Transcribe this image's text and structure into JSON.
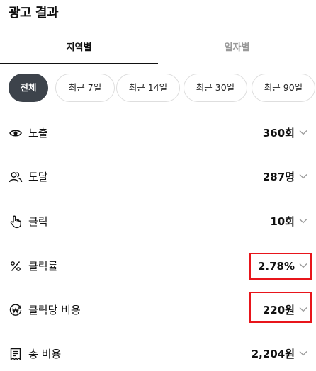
{
  "page": {
    "title": "광고 결과"
  },
  "tabs": [
    {
      "label": "지역별",
      "active": true
    },
    {
      "label": "일자별",
      "active": false
    }
  ],
  "periods": [
    {
      "label": "전체",
      "active": true
    },
    {
      "label": "최근 7일",
      "active": false
    },
    {
      "label": "최근 14일",
      "active": false
    },
    {
      "label": "최근 30일",
      "active": false
    },
    {
      "label": "최근 90일",
      "active": false
    }
  ],
  "metrics": [
    {
      "label": "노출",
      "value": "360회",
      "icon": "eye-icon"
    },
    {
      "label": "도달",
      "value": "287명",
      "icon": "people-icon"
    },
    {
      "label": "클릭",
      "value": "10회",
      "icon": "hand-pointer-icon"
    },
    {
      "label": "클릭률",
      "value": "2.78%",
      "icon": "percent-icon",
      "highlighted": true
    },
    {
      "label": "클릭당 비용",
      "value": "220원",
      "icon": "won-coin-icon",
      "highlighted": true
    },
    {
      "label": "총 비용",
      "value": "2,204원",
      "icon": "receipt-icon"
    }
  ],
  "colors": {
    "highlight": "#e8151b",
    "active_chip": "#3d434b",
    "inactive_tab": "#9a9a9a"
  }
}
